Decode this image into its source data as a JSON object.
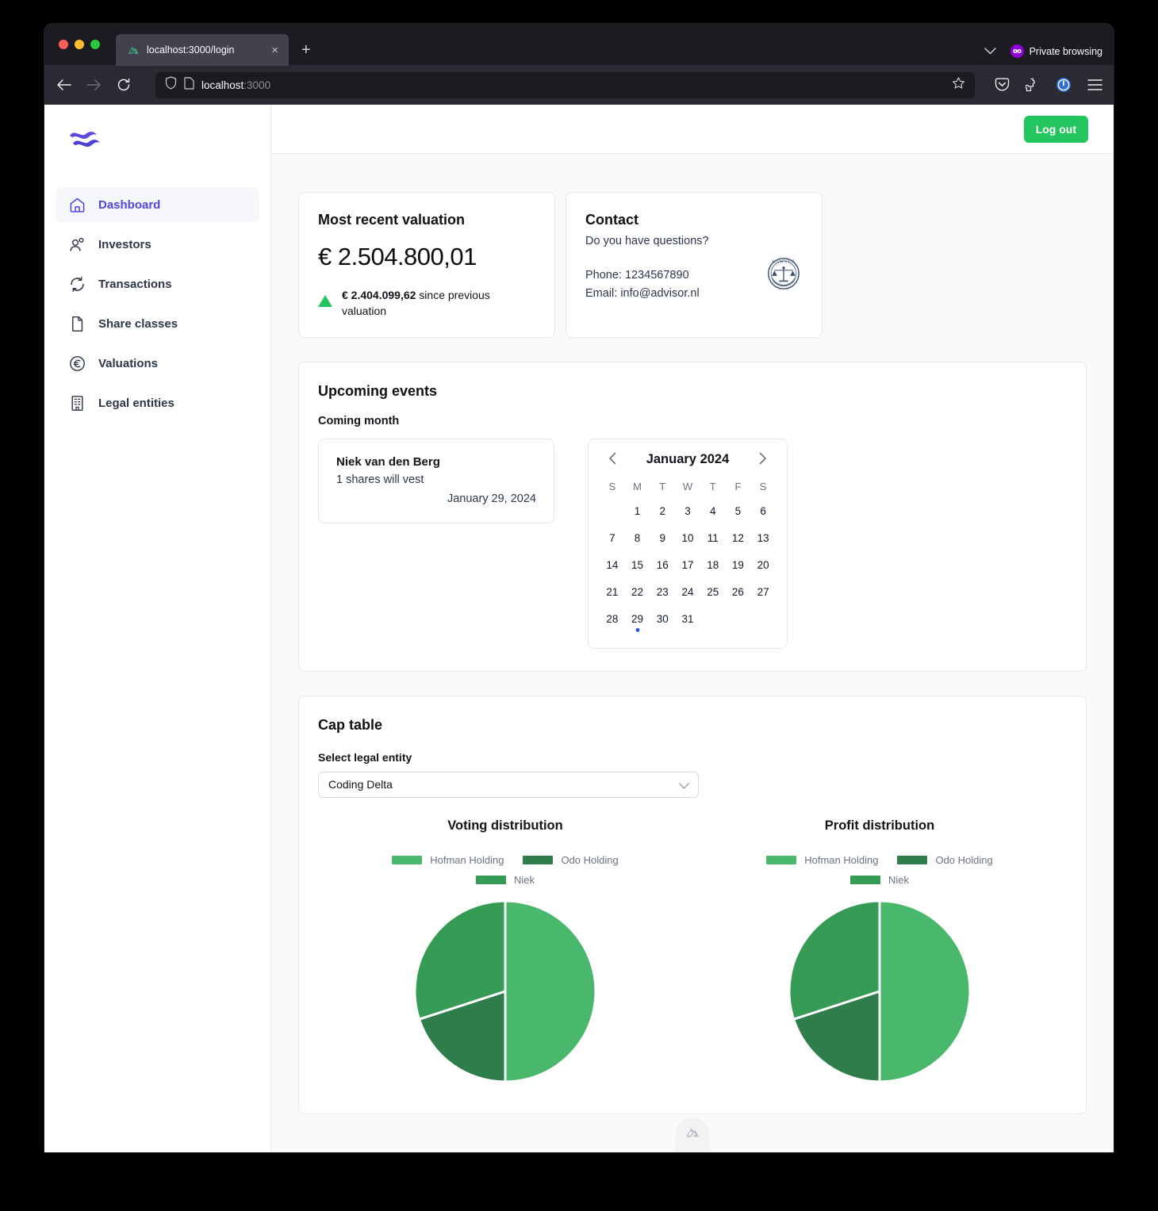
{
  "browser": {
    "tab": {
      "title": "localhost:3000/login",
      "favicon": "nuxt-logo-icon",
      "close": "×"
    },
    "new_tab": "+",
    "private_browsing": "Private browsing",
    "url_host": "localhost",
    "url_port": ":3000",
    "toolbar_icons": [
      "back-icon",
      "forward-icon",
      "reload-icon",
      "shield-icon",
      "page-icon",
      "bookmark-star-icon",
      "pocket-icon",
      "extensions-icon",
      "password-manager-icon",
      "app-menu-icon"
    ]
  },
  "sidebar": {
    "logo": "wave-logo",
    "items": [
      {
        "label": "Dashboard",
        "icon": "home-icon",
        "active": true
      },
      {
        "label": "Investors",
        "icon": "users-icon",
        "active": false
      },
      {
        "label": "Transactions",
        "icon": "refresh-icon",
        "active": false
      },
      {
        "label": "Share classes",
        "icon": "document-icon",
        "active": false
      },
      {
        "label": "Valuations",
        "icon": "euro-circle-icon",
        "active": false
      },
      {
        "label": "Legal entities",
        "icon": "building-icon",
        "active": false
      }
    ]
  },
  "topbar": {
    "logout_label": "Log out",
    "logout_color": "#22c55e"
  },
  "valuation": {
    "title": "Most recent valuation",
    "amount": "€ 2.504.800,01",
    "delta_amount": "€ 2.404.099,62",
    "delta_suffix": " since previous valuation",
    "delta_direction": "up",
    "delta_color": "#22c55e"
  },
  "contact": {
    "title": "Contact",
    "subtitle": "Do you have questions?",
    "phone": "Phone: 1234567890",
    "email": "Email: info@advisor.nl",
    "logo": "lawyer-seal-icon",
    "logo_text": "LAWYER"
  },
  "events": {
    "title": "Upcoming events",
    "subtitle": "Coming month",
    "items": [
      {
        "name": "Niek van den Berg",
        "description": "1 shares will vest",
        "date": "January 29, 2024"
      }
    ]
  },
  "calendar": {
    "month_label": "January 2024",
    "prev_icon": "chevron-left-icon",
    "next_icon": "chevron-right-icon",
    "day_headers": [
      "S",
      "M",
      "T",
      "W",
      "T",
      "F",
      "S"
    ],
    "leading_blanks": 1,
    "days": [
      1,
      2,
      3,
      4,
      5,
      6,
      7,
      8,
      9,
      10,
      11,
      12,
      13,
      14,
      15,
      16,
      17,
      18,
      19,
      20,
      21,
      22,
      23,
      24,
      25,
      26,
      27,
      28,
      29,
      30,
      31
    ],
    "event_days": [
      29
    ],
    "event_dot_color": "#2b5fd9"
  },
  "cap_table": {
    "title": "Cap table",
    "select_label": "Select legal entity",
    "selected_entity": "Coding Delta",
    "chevron_icon": "chevron-down-icon"
  },
  "chart_data": [
    {
      "type": "pie",
      "title": "Voting distribution",
      "labels": [
        "Hofman Holding",
        "Odo Holding",
        "Niek"
      ],
      "values": [
        50,
        20,
        30
      ],
      "colors": [
        "#4ab86c",
        "#2e7d4a",
        "#359b55"
      ],
      "legend_position": "top",
      "legend_entries": [
        "Hofman Holding",
        "Odo Holding",
        "Niek"
      ]
    },
    {
      "type": "pie",
      "title": "Profit distribution",
      "labels": [
        "Hofman Holding",
        "Odo Holding",
        "Niek"
      ],
      "values": [
        50,
        20,
        30
      ],
      "colors": [
        "#4ab86c",
        "#2e7d4a",
        "#359b55"
      ],
      "legend_position": "top",
      "legend_entries": [
        "Hofman Holding",
        "Odo Holding",
        "Niek"
      ]
    }
  ],
  "footer": {
    "badge_icon": "nuxt-devtools-icon"
  }
}
